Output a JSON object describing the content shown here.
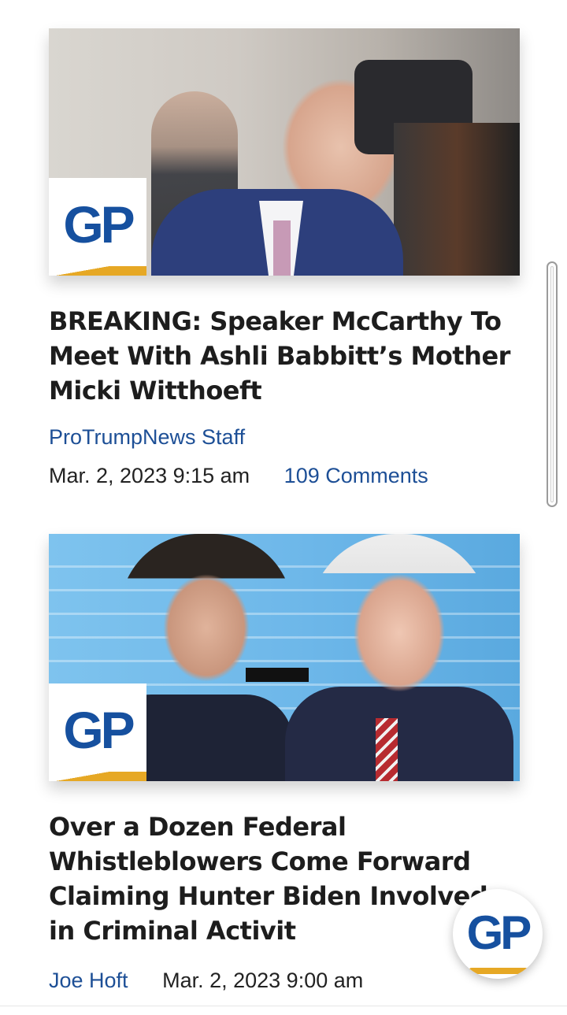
{
  "articles": [
    {
      "headline": "BREAKING: Speaker McCarthy To Meet With Ashli Babbitt’s Mother Micki Witthoeft",
      "author": "ProTrumpNews Staff",
      "date": "Mar. 2, 2023 9:15 am",
      "comments": "109 Comments",
      "badge": "GP"
    },
    {
      "headline": "Over a Dozen Federal Whistleblowers Come Forward Claiming Hunter Biden Involved in Criminal Activit",
      "author": "Joe Hoft",
      "date": "Mar. 2, 2023 9:00 am",
      "badge": "GP"
    }
  ],
  "fab": {
    "label": "GP"
  },
  "colors": {
    "brand_blue": "#16509f",
    "link_blue": "#1d4f96",
    "accent_gold": "#e6a825"
  }
}
